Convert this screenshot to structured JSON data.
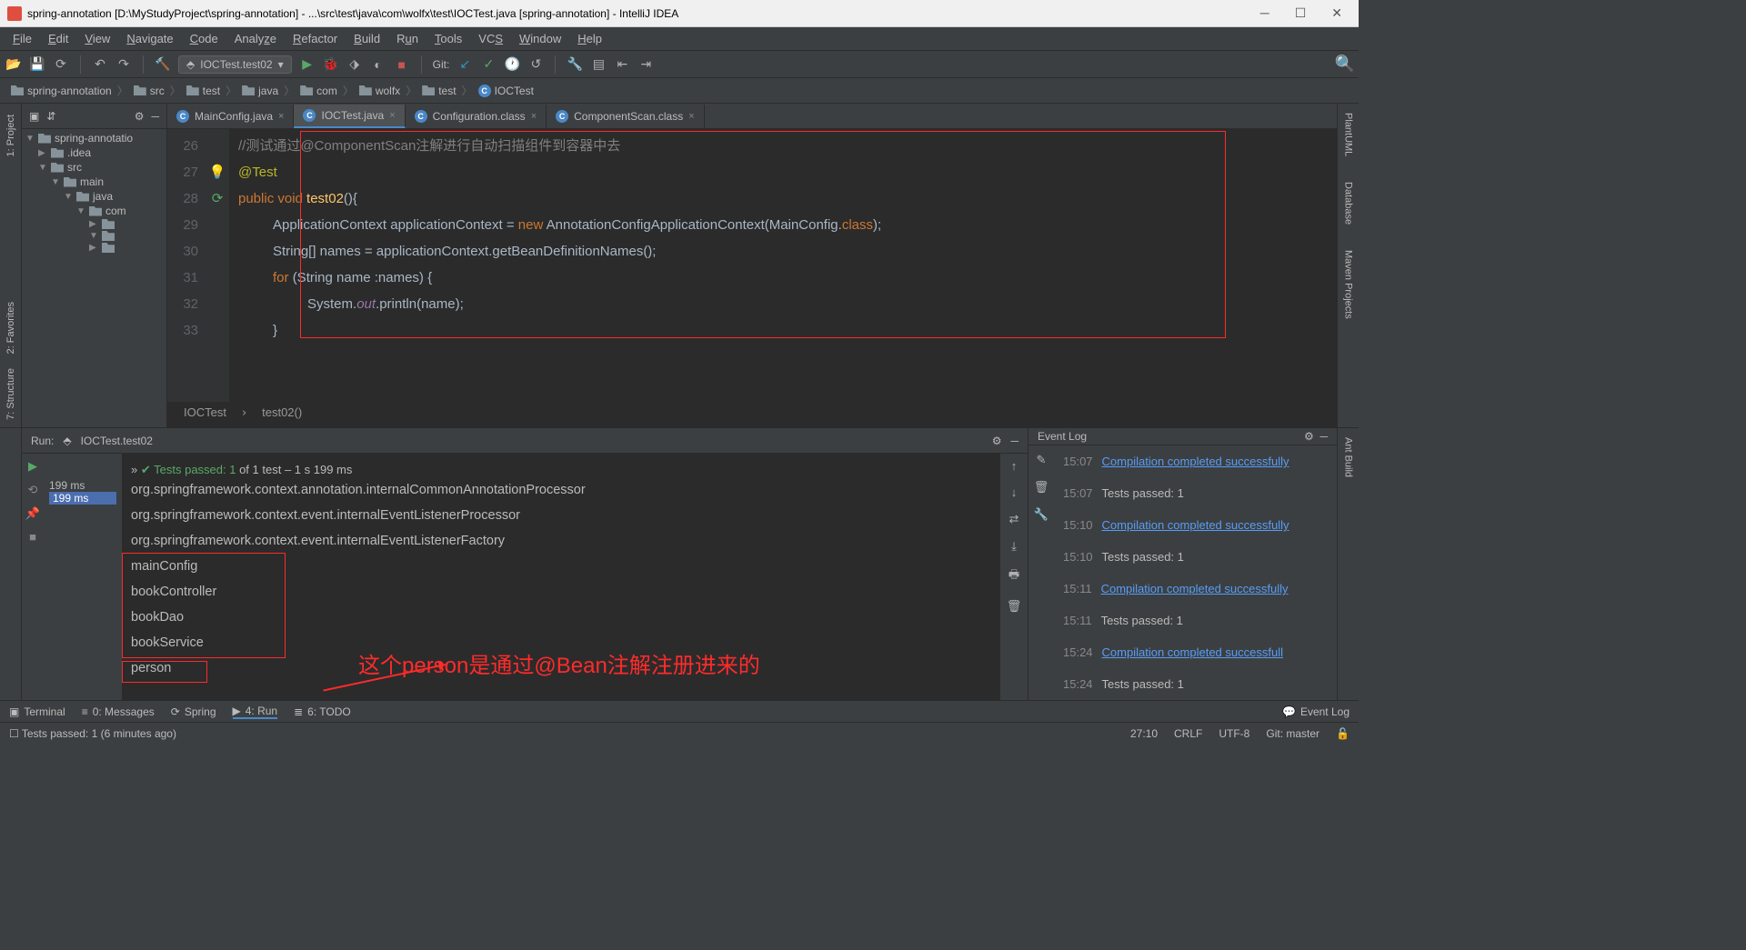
{
  "window": {
    "title": "spring-annotation [D:\\MyStudyProject\\spring-annotation] - ...\\src\\test\\java\\com\\wolfx\\test\\IOCTest.java [spring-annotation] - IntelliJ IDEA"
  },
  "menu": [
    "File",
    "Edit",
    "View",
    "Navigate",
    "Code",
    "Analyze",
    "Refactor",
    "Build",
    "Run",
    "Tools",
    "VCS",
    "Window",
    "Help"
  ],
  "toolbar": {
    "run_config": "IOCTest.test02",
    "git_label": "Git:"
  },
  "breadcrumbs": [
    "spring-annotation",
    "src",
    "test",
    "java",
    "com",
    "wolfx",
    "test",
    "IOCTest"
  ],
  "project_tree": {
    "root": "spring-annotatio",
    "items": [
      {
        "indent": 0,
        "arrow": "▼",
        "icon": "folder",
        "label": "spring-annotatio"
      },
      {
        "indent": 1,
        "arrow": "▶",
        "icon": "folder",
        "label": ".idea"
      },
      {
        "indent": 1,
        "arrow": "▼",
        "icon": "folder",
        "label": "src"
      },
      {
        "indent": 2,
        "arrow": "▼",
        "icon": "folder",
        "label": "main"
      },
      {
        "indent": 3,
        "arrow": "▼",
        "icon": "folder-src",
        "label": "java"
      },
      {
        "indent": 4,
        "arrow": "▼",
        "icon": "pkg",
        "label": "com"
      },
      {
        "indent": 5,
        "arrow": "▶",
        "icon": "pkg",
        "label": ""
      },
      {
        "indent": 5,
        "arrow": "▼",
        "icon": "pkg",
        "label": ""
      },
      {
        "indent": 5,
        "arrow": "▶",
        "icon": "pkg",
        "label": ""
      }
    ]
  },
  "tabs": [
    {
      "label": "MainConfig.java",
      "active": false
    },
    {
      "label": "IOCTest.java",
      "active": true
    },
    {
      "label": "Configuration.class",
      "active": false
    },
    {
      "label": "ComponentScan.class",
      "active": false
    }
  ],
  "line_numbers": [
    "26",
    "27",
    "28",
    "29",
    "30",
    "31",
    "32",
    "33"
  ],
  "code": {
    "l26": "//测试通过@ComponentScan注解进行自动扫描组件到容器中去",
    "l27": "@Test",
    "l28_public": "public ",
    "l28_void": "void ",
    "l28_fn": "test02",
    "l28_rest": "(){",
    "l29_a": "ApplicationContext applicationContext = ",
    "l29_new": "new ",
    "l29_b": "AnnotationConfigApplicationContext(MainConfig.",
    "l29_class": "class",
    "l29_c": ");",
    "l30": "String[] names = applicationContext.getBeanDefinitionNames();",
    "l31_for": "for ",
    "l31_rest": "(String name :names) {",
    "l32_a": "System.",
    "l32_out": "out",
    "l32_b": ".println(name);",
    "l33": "}"
  },
  "code_breadcrumb": {
    "cls": "IOCTest",
    "fn": "test02()"
  },
  "run": {
    "title": "IOCTest.test02",
    "tests_line_a": "Tests passed: 1",
    "tests_line_b": " of 1 test – 1 s 199 ms",
    "dur1": "199 ms",
    "dur2": "199 ms",
    "output": [
      "org.springframework.context.annotation.internalCommonAnnotationProcessor",
      "org.springframework.context.event.internalEventListenerProcessor",
      "org.springframework.context.event.internalEventListenerFactory",
      "mainConfig",
      "bookController",
      "bookDao",
      "bookService",
      "person"
    ],
    "annotation": "这个person是通过@Bean注解注册进来的"
  },
  "event_log": {
    "title": "Event Log",
    "items": [
      {
        "time": "15:07",
        "text": "Compilation completed successfully",
        "link": true
      },
      {
        "time": "15:07",
        "text": "Tests passed: 1",
        "link": false
      },
      {
        "time": "15:10",
        "text": "Compilation completed successfully",
        "link": true
      },
      {
        "time": "15:10",
        "text": "Tests passed: 1",
        "link": false
      },
      {
        "time": "15:11",
        "text": "Compilation completed successfully",
        "link": true
      },
      {
        "time": "15:11",
        "text": "Tests passed: 1",
        "link": false
      },
      {
        "time": "15:24",
        "text": "Compilation completed successfull",
        "link": true
      },
      {
        "time": "15:24",
        "text": "Tests passed: 1",
        "link": false
      }
    ]
  },
  "bottom_tabs": [
    "Terminal",
    "0: Messages",
    "Spring",
    "4: Run",
    "6: TODO"
  ],
  "statusbar": {
    "left": "Tests passed: 1 (6 minutes ago)",
    "pos": "27:10",
    "eol": "CRLF",
    "enc": "UTF-8",
    "git": "Git: master",
    "eventlog": "Event Log"
  },
  "side_tabs": {
    "left": "1: Project",
    "left2": "2: Favorites",
    "left3": "7: Structure",
    "right": [
      "PlantUML",
      "Database",
      "Maven Projects"
    ],
    "right2": "Ant Build"
  }
}
